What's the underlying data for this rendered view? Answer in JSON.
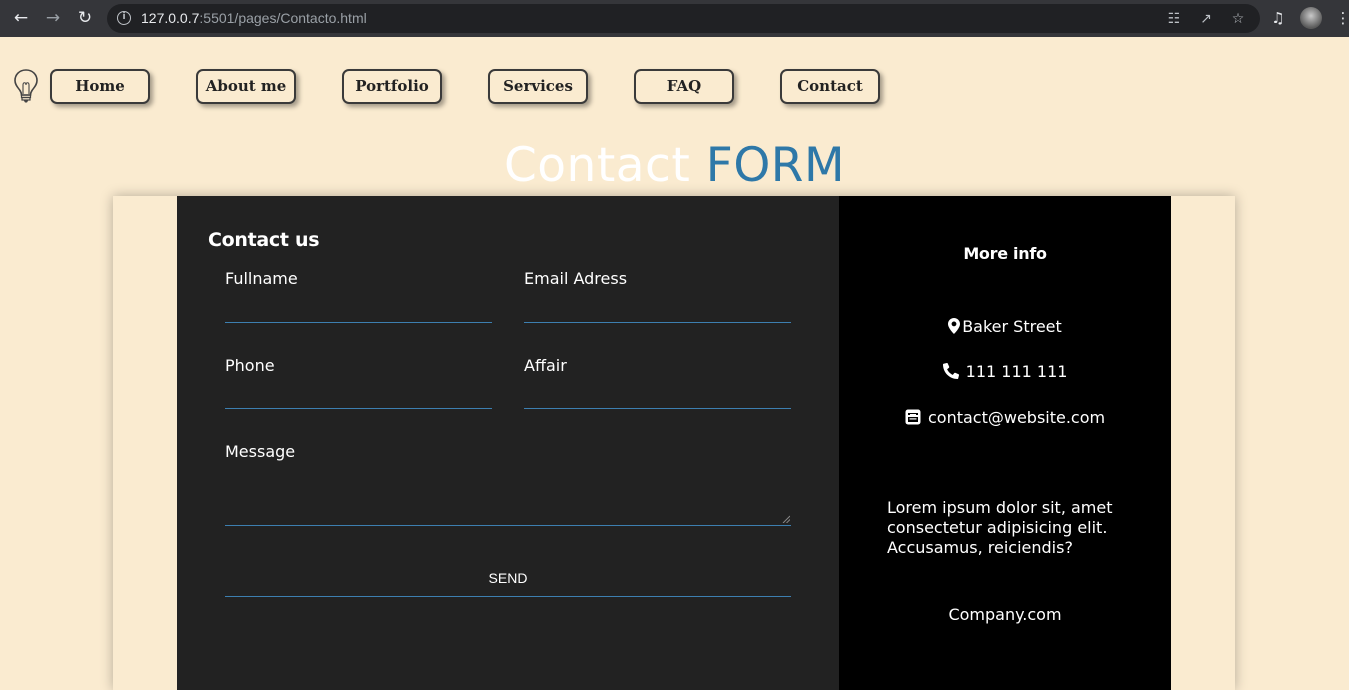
{
  "browser": {
    "url_host": "127.0.0.7",
    "url_rest": ":5501/pages/Contacto.html"
  },
  "nav": {
    "items": [
      {
        "label": "Home"
      },
      {
        "label": "About me"
      },
      {
        "label": "Portfolio"
      },
      {
        "label": "Services"
      },
      {
        "label": "FAQ"
      },
      {
        "label": "Contact"
      }
    ]
  },
  "heading": {
    "part1": "Contact",
    "part2": "FORM"
  },
  "form": {
    "title": "Contact us",
    "fullname_label": "Fullname",
    "email_label": "Email Adress",
    "phone_label": "Phone",
    "affair_label": "Affair",
    "message_label": "Message",
    "send_label": "SEND"
  },
  "info": {
    "title": "More info",
    "address": "Baker Street",
    "phone": "111 111 111",
    "email": "contact@website.com",
    "description": "Lorem ipsum dolor sit, amet consectetur adipisicing elit. Accusamus, reiciendis?",
    "company": "Company.com"
  },
  "colors": {
    "page_bg": "#faebd0",
    "form_bg": "#222222",
    "info_bg": "#000000",
    "accent": "#2e78a8"
  }
}
